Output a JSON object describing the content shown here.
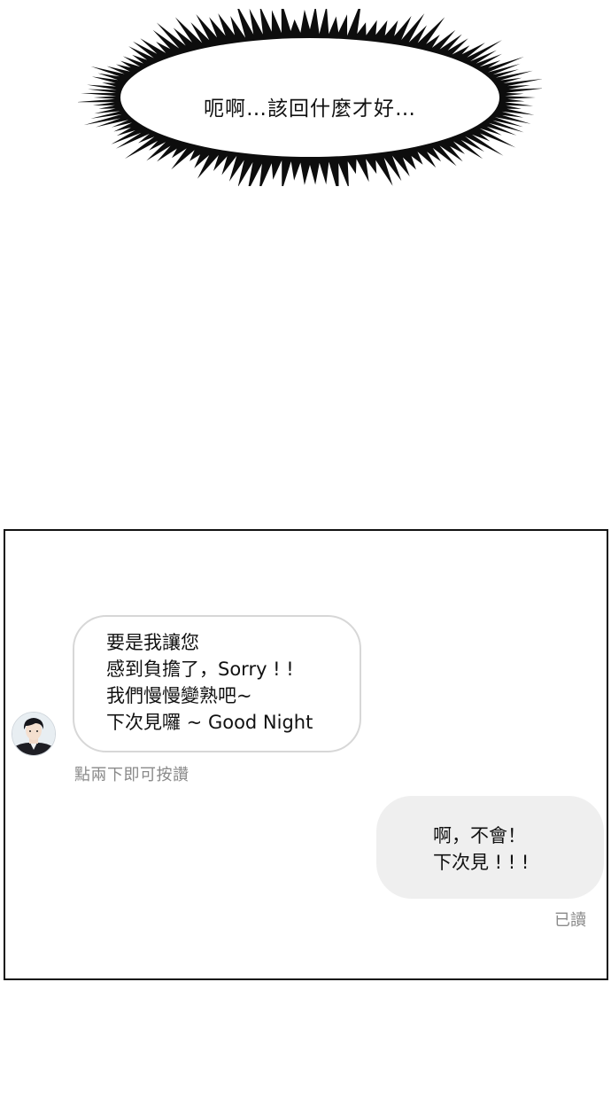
{
  "thought": {
    "text": "呃啊…該回什麼才好…"
  },
  "chat": {
    "avatar_icon": "person-avatar-icon",
    "incoming": {
      "lines": [
        "要是我讓您",
        "感到負擔了，Sorry ! !",
        "我們慢慢變熟吧~",
        "下次見囉 ~ Good Night"
      ],
      "hint": "點兩下即可按讚"
    },
    "outgoing": {
      "lines": [
        "啊，不會！",
        "下次見 ! ! !"
      ],
      "receipt": "已讀"
    }
  },
  "colors": {
    "page_background": "#ffffff",
    "panel_border": "#111111",
    "incoming_bubble_border": "#d7d7d7",
    "outgoing_bubble_fill": "#efefef",
    "meta_text": "#8a8a8a"
  }
}
